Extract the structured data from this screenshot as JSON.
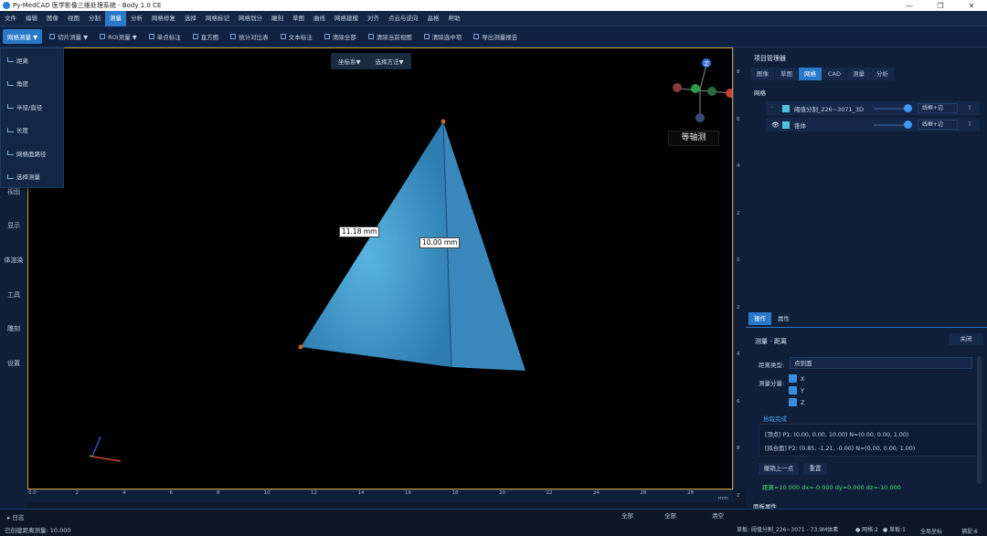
{
  "app": {
    "title": "Py-MedCAD 医学影像三维处理系统 - Body 1.0 CE",
    "window_controls": [
      "—",
      "❐",
      "✕"
    ]
  },
  "menu": [
    "文件",
    "编辑",
    "图像",
    "视图",
    "分割",
    "测量",
    "分析",
    "网格修复",
    "选择",
    "网格标记",
    "网格划分",
    "雕刻",
    "草图",
    "曲线",
    "网格建模",
    "对齐",
    "点云与逆向",
    "晶格",
    "帮助"
  ],
  "menu_active_index": 5,
  "toolbar": [
    {
      "label": "网格测量 ▼"
    },
    {
      "label": "切片测量 ▼"
    },
    {
      "label": "ROI测量 ▼"
    },
    {
      "label": "单点标注"
    },
    {
      "label": "直方图"
    },
    {
      "label": "统计对比表"
    },
    {
      "label": "文本标注"
    },
    {
      "label": "清除全部"
    },
    {
      "label": "清除当前视图"
    },
    {
      "label": "清除选中项"
    },
    {
      "label": "导出测量报告"
    }
  ],
  "dropdown_items": [
    "距离",
    "角度",
    "半径/直径",
    "长度",
    "网格面路径",
    "选择测量"
  ],
  "left_sidebar": [
    "视图",
    "显示",
    "体渲染",
    "工具",
    "雕刻",
    "设置"
  ],
  "viewport": {
    "buttons": [
      "坐标系▼",
      "选择方法▼"
    ],
    "label_a": "11.18 mm",
    "label_b": "10.00 mm",
    "view_label": "等轴测",
    "axis_z": "Z",
    "vruler_ticks": [
      "8",
      "6",
      "4",
      "2",
      "0",
      "2",
      "4",
      "6",
      "8",
      "2"
    ],
    "hruler_ticks": [
      "0.0",
      "2",
      "4",
      "6",
      "8",
      "10",
      "12",
      "14",
      "16",
      "18",
      "20",
      "22",
      "24",
      "26",
      "28"
    ],
    "hruler_unit": "mm"
  },
  "project_manager": {
    "title": "项目管理器",
    "tabs": [
      "图像",
      "草图",
      "网格",
      "CAD",
      "测量",
      "分析"
    ],
    "active_tab": 2,
    "section": "网格",
    "meshes": [
      {
        "name": "阈值分割_226~3071_3D",
        "mode": "线框+边",
        "color": "#4fc3dc"
      },
      {
        "name": "锥体",
        "mode": "线框+边",
        "color": "#4fc3dc"
      }
    ]
  },
  "operations": {
    "tabs": [
      "操作",
      "属性"
    ],
    "title": "测量 - 距离",
    "close": "关闭",
    "distance_type_label": "距离类型:",
    "distance_type_value": "点到面",
    "components_label": "测量分量:",
    "components": [
      "X",
      "Y",
      "Z"
    ],
    "status": "拾取完成",
    "line1": "[顶点] P1: (0.00, 0.00, 10.00)  N=(0.00, 0.00, 1.00)",
    "line2": "[拟合面] P2: (0.85, -1.21, -0.00)  N=(0.00, 0.00, 1.00)",
    "undo": "撤销上一点",
    "reset": "重置",
    "result": "距离=10.000  dx=-0.000 dy=0.000 dz=-10.000"
  },
  "panel_props": "面板属性",
  "status": {
    "log": "▸ 日志",
    "message": "已创建距离测量: 10.000",
    "all1": "全部",
    "all2": "全部",
    "clear": "清空",
    "mesh_info": "草板: 阈值分割_226~3071 - 73.9M体素",
    "mesh_count": "● 网格:2",
    "sketch_count": "● 草板:1",
    "coords": "全局坐标",
    "capture": "捕捉:6"
  }
}
